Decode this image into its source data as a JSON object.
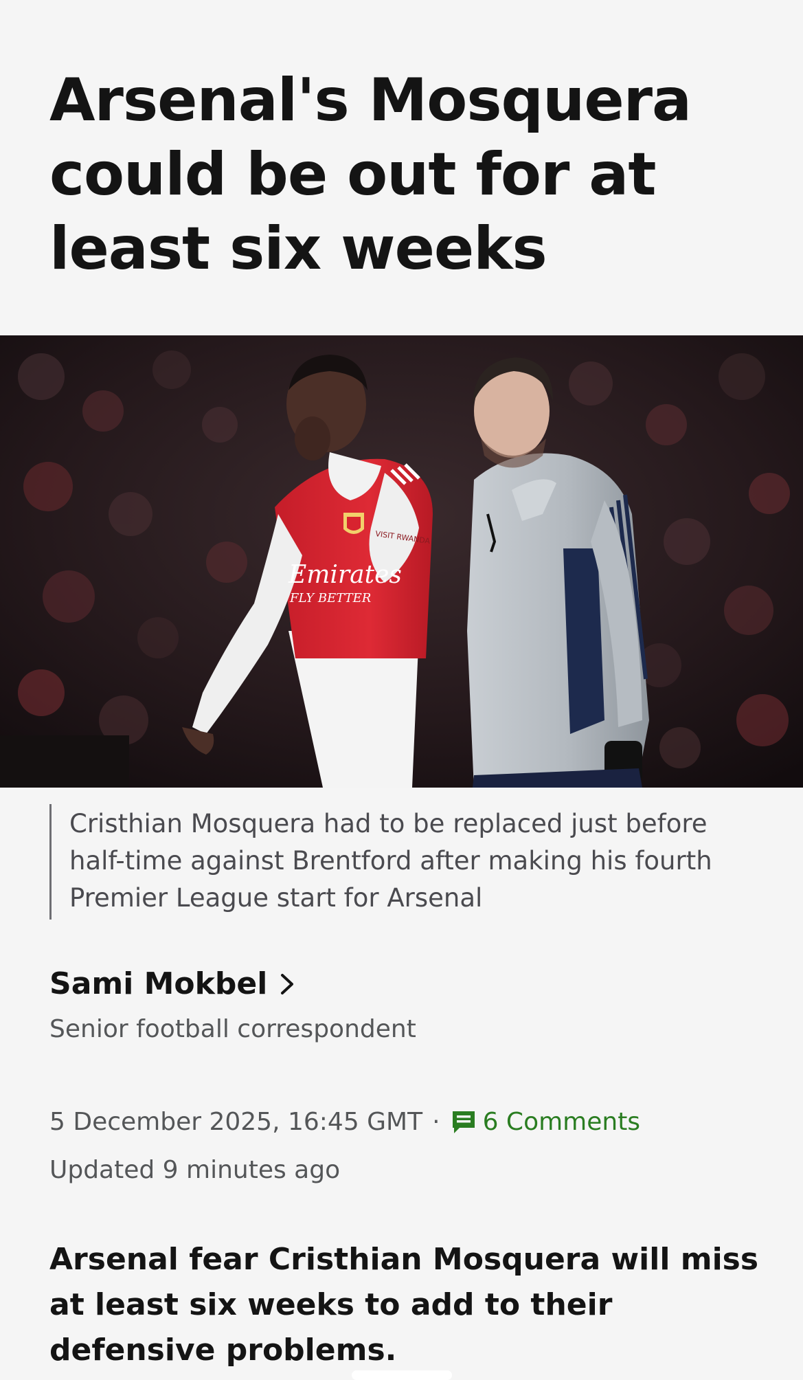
{
  "article": {
    "headline": "Arsenal's Mosquera could be out for at least six weeks",
    "image": {
      "kit_sponsor": "Emirates",
      "kit_slogan": "FLY BETTER",
      "sleeve_sponsor": "VISIT RWANDA",
      "kit_colors": {
        "home_red": "#d8232f",
        "sleeve_white": "#f2f2f2",
        "staff_jacket": "#bfc4c9",
        "navy": "#1d2a4d"
      }
    },
    "caption": "Cristhian Mosquera had to be replaced just before half-time against Brentford after making his fourth Premier League start for Arsenal",
    "author": {
      "name": "Sami Mokbel",
      "role": "Senior football correspondent"
    },
    "meta": {
      "date": "5 December 2025, 16:45 GMT",
      "separator": "·",
      "comments": "6 Comments",
      "updated": "Updated 9 minutes ago"
    },
    "lead": "Arsenal fear Cristhian Mosquera will miss at least six weeks to add to their defensive problems."
  },
  "colors": {
    "background": "#f5f5f5",
    "text": "#141414",
    "muted": "#545658",
    "comments_green": "#2a7d21"
  },
  "icons": {
    "author_chevron": "chevron-right-icon",
    "comments": "comment-icon"
  }
}
